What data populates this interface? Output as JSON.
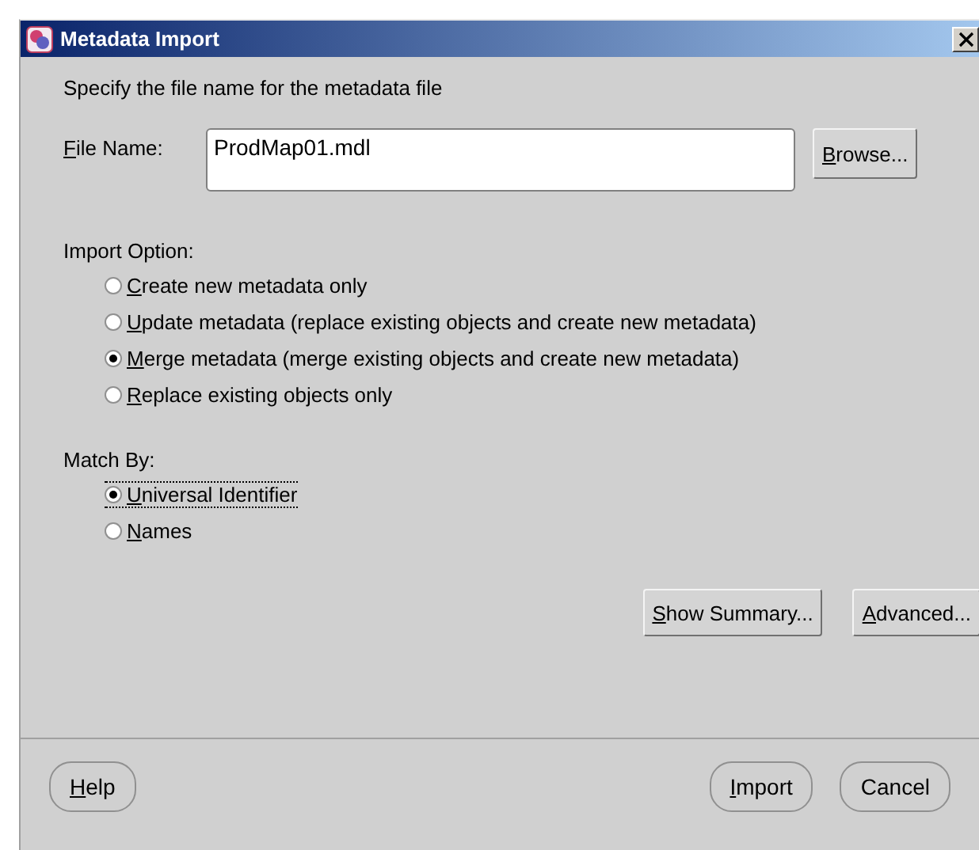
{
  "window": {
    "title": "Metadata Import"
  },
  "instruction": "Specify the file name for the metadata file",
  "file_name": {
    "label": "File Name:",
    "mnemonic": true,
    "value": "ProdMap01.mdl"
  },
  "browse_button": {
    "label": "Browse...",
    "mnemonic": true
  },
  "import_option": {
    "label": "Import Option:",
    "options": [
      {
        "label": "Create new metadata only",
        "selected": false,
        "focused": false,
        "mnemonic": true
      },
      {
        "label": "Update metadata (replace existing objects and create new metadata)",
        "selected": false,
        "focused": false,
        "mnemonic": true
      },
      {
        "label": "Merge metadata (merge existing objects and create new metadata)",
        "selected": true,
        "focused": false,
        "mnemonic": true
      },
      {
        "label": "Replace existing objects only",
        "selected": false,
        "focused": false,
        "mnemonic": true
      }
    ]
  },
  "match_by": {
    "label": "Match By:",
    "options": [
      {
        "label": "Universal Identifier",
        "selected": true,
        "focused": true,
        "mnemonic": true
      },
      {
        "label": "Names",
        "selected": false,
        "focused": false,
        "mnemonic": true
      }
    ]
  },
  "action_buttons": [
    {
      "label": "Show Summary...",
      "mnemonic": true
    },
    {
      "label": "Advanced...",
      "mnemonic": true
    }
  ],
  "footer": {
    "left": [
      {
        "label": "Help",
        "mnemonic": true
      }
    ],
    "right": [
      {
        "label": "Import",
        "mnemonic": true
      },
      {
        "label": "Cancel",
        "mnemonic": false
      }
    ]
  }
}
